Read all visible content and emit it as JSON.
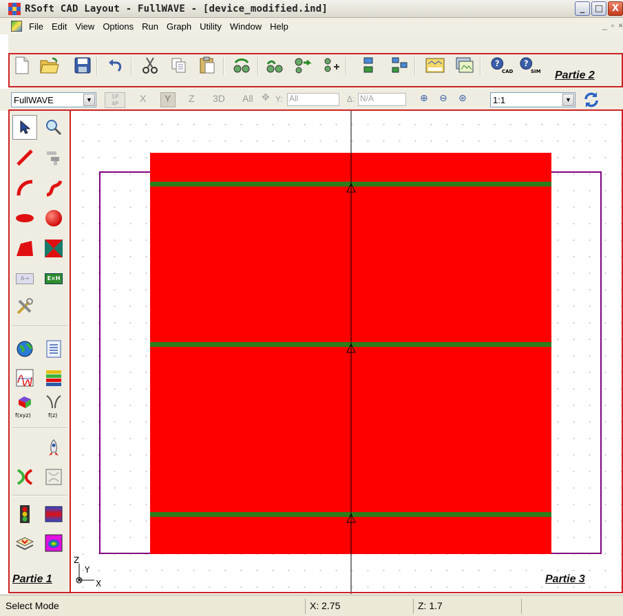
{
  "window": {
    "title": "RSoft CAD Layout - FullWAVE - [device_modified.ind]",
    "controls": [
      "_",
      "□",
      "X"
    ]
  },
  "menu": {
    "items": [
      "File",
      "Edit",
      "View",
      "Options",
      "Run",
      "Graph",
      "Utility",
      "Window",
      "Help"
    ],
    "mdi_controls": [
      "_",
      "▫",
      "×"
    ]
  },
  "toolbar_main": {
    "buttons": [
      "new-icon",
      "open-icon",
      "save-icon",
      "undo-icon",
      "cut-icon",
      "copy-icon",
      "paste-icon",
      "group-icon",
      "ungroup-icon",
      "align-icon",
      "add-component-icon",
      "array-icon",
      "distribute-icon",
      "scan-icon",
      "display-icon",
      "help-cad-icon",
      "help-sim-icon"
    ],
    "help_cad_label": "CAD",
    "help_sim_label": "SIM",
    "section_label": "Partie 2"
  },
  "toolbar_view": {
    "simulator": "FullWAVE",
    "btn_1p_top": "1P",
    "btn_1p_bottom": "4P",
    "axis_x": "X",
    "axis_y": "Y",
    "axis_z": "Z",
    "view_3d": "3D",
    "view_all": "All",
    "y_label": "Y:",
    "y_value": "All",
    "delta_label": "Δ:",
    "delta_value": "N/A",
    "zoom_ratio": "1:1"
  },
  "palette": {
    "section_label": "Partie 1",
    "fxyz_label": "f(xyz)",
    "fz_label": "f(z)",
    "az_label": "A→",
    "exh_label": "E×H"
  },
  "canvas": {
    "section_label": "Partie 3",
    "axis_z": "Z",
    "axis_y": "Y",
    "axis_x": "X",
    "colors": {
      "waveguide": "#ff0000",
      "grating_line": "#2e7d1a",
      "boundary": "#800080",
      "guide_line": "#000000"
    }
  },
  "status": {
    "mode": "Select Mode",
    "x": "X: 2.75",
    "z": "Z: 1.7"
  }
}
